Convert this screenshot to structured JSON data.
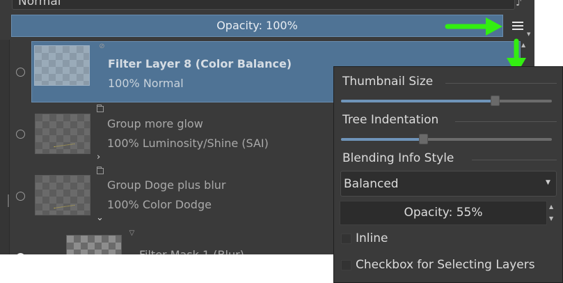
{
  "docker": {
    "blend_mode": "Normal",
    "opacity_label": "Opacity:  100%",
    "menu_icon": "hamburger-menu-icon"
  },
  "layers": [
    {
      "name": "Filter Layer 8 (Color Balance)",
      "info": "100% Normal",
      "type_icon": "filter-layer-icon",
      "selected": true
    },
    {
      "name": "Group more glow",
      "info": "100% Luminosity/Shine (SAI)",
      "type_icon": "folder-icon",
      "expander": ">"
    },
    {
      "name": "Group Doge plus blur",
      "info": "100% Color Dodge",
      "type_icon": "folder-icon",
      "expander": "v"
    },
    {
      "name": "Filter Mask 1 (Blur)",
      "type_icon": "filter-mask-icon"
    }
  ],
  "popup": {
    "thumbnail_size_title": "Thumbnail Size",
    "thumbnail_size_value": 0.73,
    "tree_indentation_title": "Tree Indentation",
    "tree_indentation_value": 0.39,
    "blending_info_style_title": "Blending Info Style",
    "blending_info_style_value": "Balanced",
    "opacity_label": "Opacity:  55%",
    "inline_label": "Inline",
    "inline_checked": false,
    "checkbox_select_label": "Checkbox for Selecting Layers",
    "checkbox_select_checked": false
  },
  "colors": {
    "panel_bg": "#3a3a3a",
    "selection_blue": "#4f7395",
    "slider_fill": "#6f94b9",
    "annotation_arrow": "#33ee11"
  }
}
